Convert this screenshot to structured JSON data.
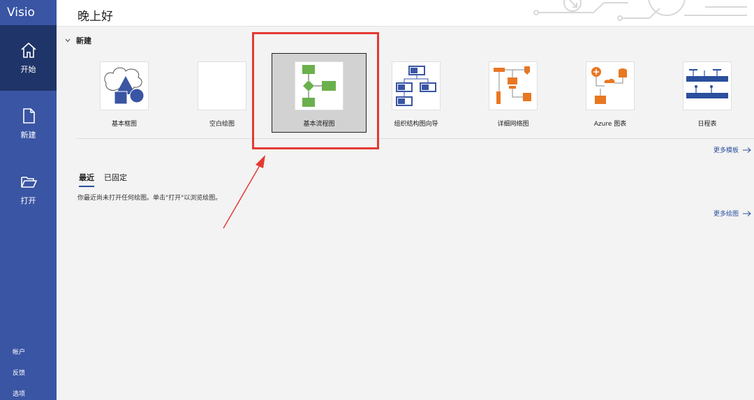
{
  "app": {
    "name": "Visio"
  },
  "sidebar": {
    "items": [
      {
        "label": "开始",
        "icon": "home-icon"
      },
      {
        "label": "新建",
        "icon": "new-document-icon"
      },
      {
        "label": "打开",
        "icon": "folder-open-icon"
      }
    ],
    "footer": [
      "帐户",
      "反馈",
      "选项"
    ]
  },
  "header": {
    "greeting": "晚上好"
  },
  "new_section": {
    "title": "新建",
    "templates": [
      {
        "label": "基本框图"
      },
      {
        "label": "空白绘图"
      },
      {
        "label": "基本流程图",
        "selected": true
      },
      {
        "label": "组织结构图向导"
      },
      {
        "label": "详细网络图"
      },
      {
        "label": "Azure 图表"
      },
      {
        "label": "日程表"
      }
    ],
    "more_templates": "更多模板"
  },
  "recent": {
    "tabs": [
      {
        "label": "最近",
        "active": true
      },
      {
        "label": "已固定"
      }
    ],
    "empty_message": "你最近尚未打开任何绘图。单击\"打开\"以浏览绘图。",
    "more_drawings": "更多绘图"
  },
  "colors": {
    "sidebar": "#3955a3",
    "sidebar_active": "#1f3468",
    "accent": "#2b4f9e",
    "annotation": "#e53935"
  }
}
